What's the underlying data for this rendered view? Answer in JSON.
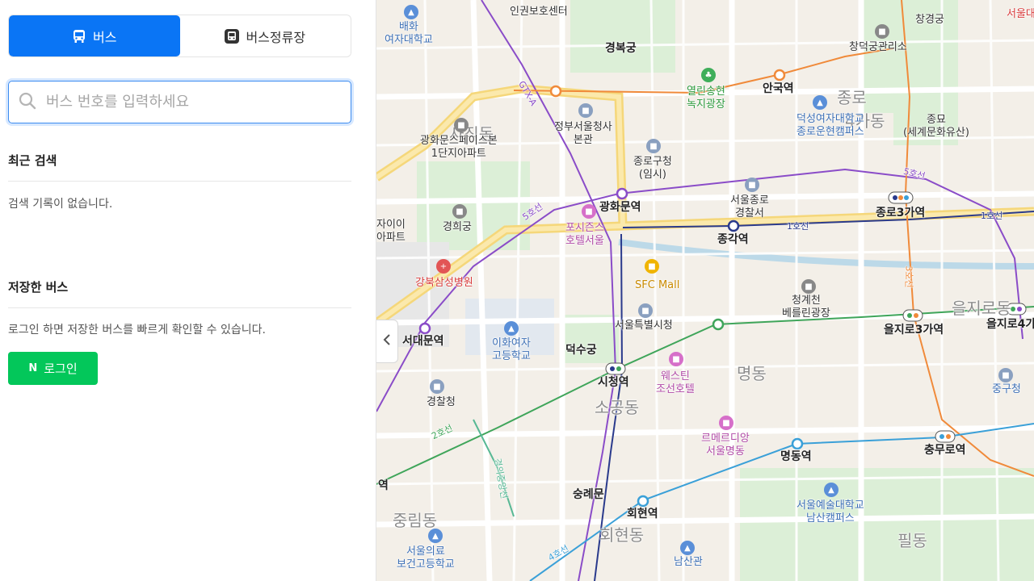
{
  "tabs": [
    {
      "label": "버스",
      "icon": "bus-icon",
      "active": true
    },
    {
      "label": "버스정류장",
      "icon": "bus-stop-icon",
      "active": false
    }
  ],
  "search": {
    "placeholder": "버스 번호를 입력하세요",
    "value": ""
  },
  "recent": {
    "title": "최근 검색",
    "empty_text": "검색 기록이 없습니다."
  },
  "saved": {
    "title": "저장한 버스",
    "text": "로그인 하면 저장한 버스를 빠르게 확인할 수 있습니다.",
    "login_label": "로그인",
    "login_badge": "N"
  },
  "colors": {
    "accent": "#0a75f5",
    "login": "#03c75a"
  },
  "map": {
    "districts": [
      "사직동",
      "종로",
      "4가동",
      "회현동",
      "명동",
      "소공동",
      "중림동",
      "필동",
      "을지로동"
    ],
    "places": [
      {
        "text": "인권보호센터"
      },
      {
        "text": "배화\n여자대학교"
      },
      {
        "text": "경복궁"
      },
      {
        "text": "열린송현\n녹지광장"
      },
      {
        "text": "안국역"
      },
      {
        "text": "창경궁"
      },
      {
        "text": "창덕궁관리소"
      },
      {
        "text": "서울대"
      },
      {
        "text": "정부서울청사\n본관"
      },
      {
        "text": "광화문스페이스본\n1단지아파트"
      },
      {
        "text": "종로구청\n(임시)"
      },
      {
        "text": "덕성여자대학교\n종로운현캠퍼스"
      },
      {
        "text": "종묘\n(세계문화유산)"
      },
      {
        "text": "경희궁"
      },
      {
        "text": "광화문역"
      },
      {
        "text": "포시즌스\n호텔서울"
      },
      {
        "text": "서울종로\n경찰서"
      },
      {
        "text": "종로3가역"
      },
      {
        "text": "종각역"
      },
      {
        "text": "자이이\n아파트"
      },
      {
        "text": "강북삼성병원"
      },
      {
        "text": "SFC Mall"
      },
      {
        "text": "청계천\n베를린광장"
      },
      {
        "text": "을지로3가역"
      },
      {
        "text": "을지로4가"
      },
      {
        "text": "서대문역"
      },
      {
        "text": "서울특별시청"
      },
      {
        "text": "이화여자\n고등학교"
      },
      {
        "text": "덕수궁"
      },
      {
        "text": "시청역"
      },
      {
        "text": "웨스틴\n조선호텔"
      },
      {
        "text": "중구청"
      },
      {
        "text": "경찰청"
      },
      {
        "text": "르메르디앙\n서울명동"
      },
      {
        "text": "명동역"
      },
      {
        "text": "충무로역"
      },
      {
        "text": "숭례문"
      },
      {
        "text": "회현역"
      },
      {
        "text": "서울예술대학교\n남산캠퍼스"
      },
      {
        "text": "서울의료\n보건고등학교"
      },
      {
        "text": "남산관"
      },
      {
        "text": "역"
      }
    ],
    "lines": [
      "1호선",
      "2호선",
      "3호선",
      "4호선",
      "5호선",
      "GTX-A",
      "경의중앙선"
    ]
  }
}
